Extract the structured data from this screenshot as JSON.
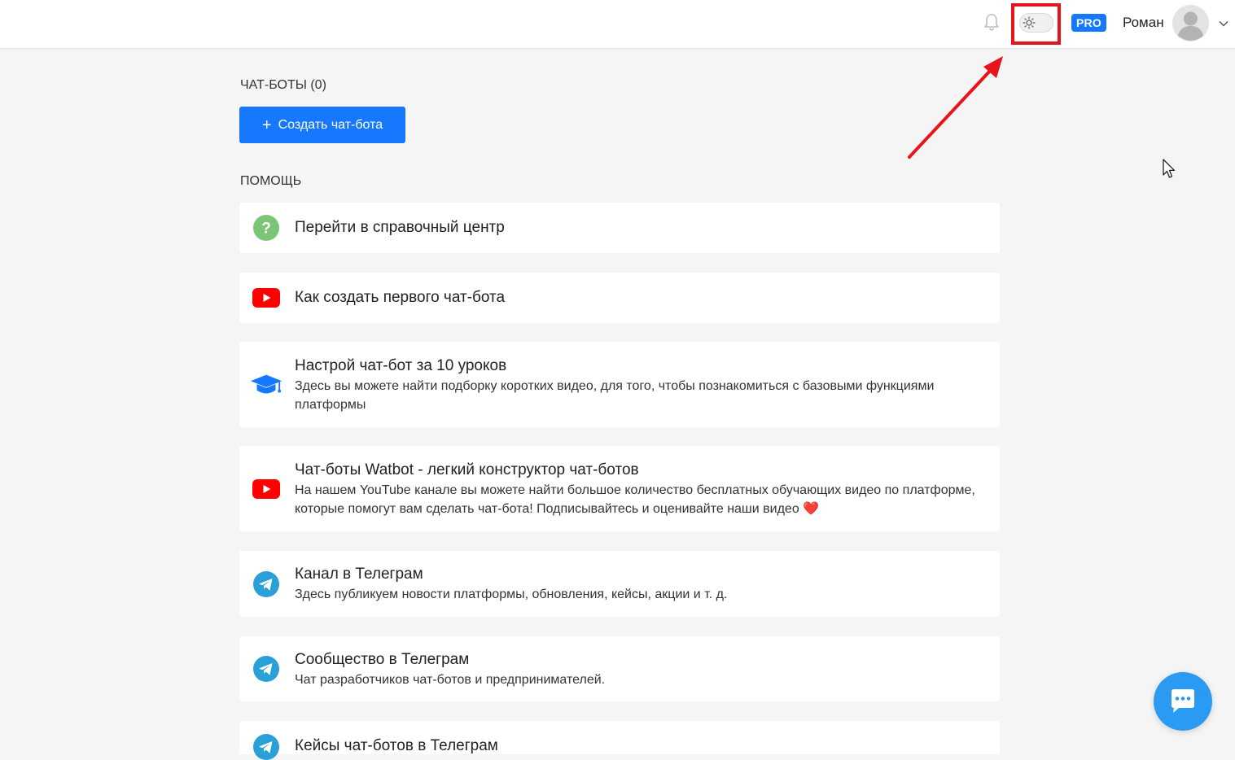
{
  "header": {
    "pro_badge": "PRO",
    "user_name": "Роман",
    "icons": [
      "bell-icon",
      "sun-icon",
      "avatar",
      "chevron-down-icon"
    ]
  },
  "chatbots": {
    "section_title": "ЧАТ-БОТЫ (0)",
    "create_button": "Создать чат-бота",
    "create_icon": "plus-icon"
  },
  "help": {
    "section_title": "ПОМОЩЬ",
    "items": [
      {
        "title": "Перейти в справочный центр",
        "desc": "",
        "icon": "question-circle-icon"
      },
      {
        "title": "Как создать первого чат-бота",
        "desc": "",
        "icon": "youtube-icon"
      },
      {
        "title": "Настрой чат-бот за 10 уроков",
        "desc": "Здесь вы можете найти подборку коротких видео, для того, чтобы познакомиться с базовыми функциями платформы",
        "icon": "graduation-cap-icon"
      },
      {
        "title": "Чат-боты Watbot - легкий конструктор чат-ботов",
        "desc": "На нашем YouTube канале вы можете найти большое количество бесплатных обучающих видео по платформе, которые помогут вам сделать чат-бота! Подписывайтесь и оценивайте наши видео ❤️",
        "icon": "youtube-icon"
      },
      {
        "title": "Канал в Телеграм",
        "desc": "Здесь публикуем новости платформы, обновления, кейсы, акции и т. д.",
        "icon": "telegram-icon"
      },
      {
        "title": "Сообщество в Телеграм",
        "desc": "Чат разработчиков чат-ботов и предпринимателей.",
        "icon": "telegram-icon"
      },
      {
        "title": "Кейсы чат-ботов в Телеграм",
        "desc": "",
        "icon": "telegram-icon"
      }
    ]
  },
  "colors": {
    "primary": "#1677ff",
    "highlight": "#e8141b",
    "youtube": "#ff0000",
    "telegram": "#2a9fd8",
    "help_green": "#7cc576",
    "chat_fab": "#2b9af3"
  }
}
